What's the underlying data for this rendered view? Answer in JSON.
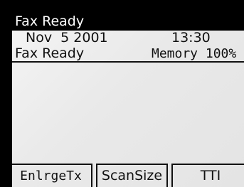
{
  "title": "Fax Ready",
  "datetime": {
    "date": "Nov  5 2001",
    "time": "13:30"
  },
  "status": {
    "state": "Fax Ready",
    "memory": "Memory 100%"
  },
  "softkeys": [
    {
      "label": "EnlrgeTx"
    },
    {
      "label": "ScanSize"
    },
    {
      "label": "TTI"
    }
  ]
}
